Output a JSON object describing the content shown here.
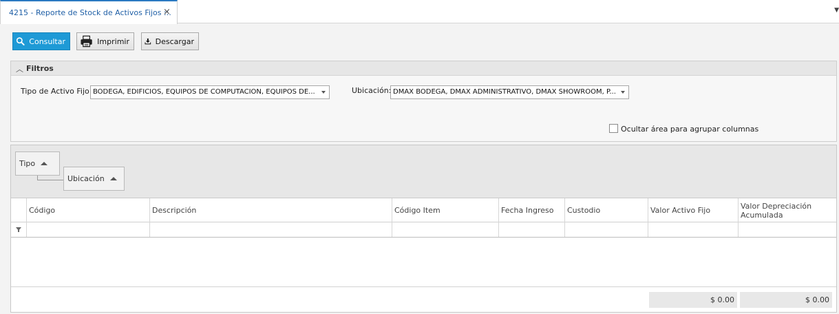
{
  "tab": {
    "title": "4215 - Reporte de Stock de Activos Fijos ::.",
    "close_icon": "close-icon",
    "menu_icon": "dropdown-arrow-icon"
  },
  "toolbar": {
    "consultar_label": "Consultar",
    "imprimir_label": "Imprimir",
    "descargar_label": "Descargar",
    "consultar_icon": "search-icon",
    "imprimir_icon": "printer-icon",
    "descargar_icon": "download-icon"
  },
  "filters": {
    "title": "Filtros",
    "tipo_label": "Tipo de Activo Fijo:",
    "tipo_value": "BODEGA, EDIFICIOS, EQUIPOS DE COMPUTACION, EQUIPOS DE...",
    "ubicacion_label": "Ubicación:",
    "ubicacion_value": "DMAX  BODEGA, DMAX ADMINISTRATIVO, DMAX SHOWROOM, P...",
    "ocultar_label": "Ocultar área para agrupar columnas",
    "ocultar_checked": false
  },
  "grid": {
    "group_chips": [
      "Tipo",
      "Ubicación"
    ],
    "columns": [
      "Código",
      "Descripción",
      "Código Item",
      "Fecha Ingreso",
      "Custodio",
      "Valor Activo Fijo",
      "Valor Depreciación Acumulada"
    ],
    "rows": [],
    "totals": {
      "valor_activo_fijo": "$ 0.00",
      "valor_depreciacion": "$ 0.00"
    }
  },
  "colors": {
    "accent": "#1e9ad6",
    "tab_text": "#1f5fa6"
  }
}
